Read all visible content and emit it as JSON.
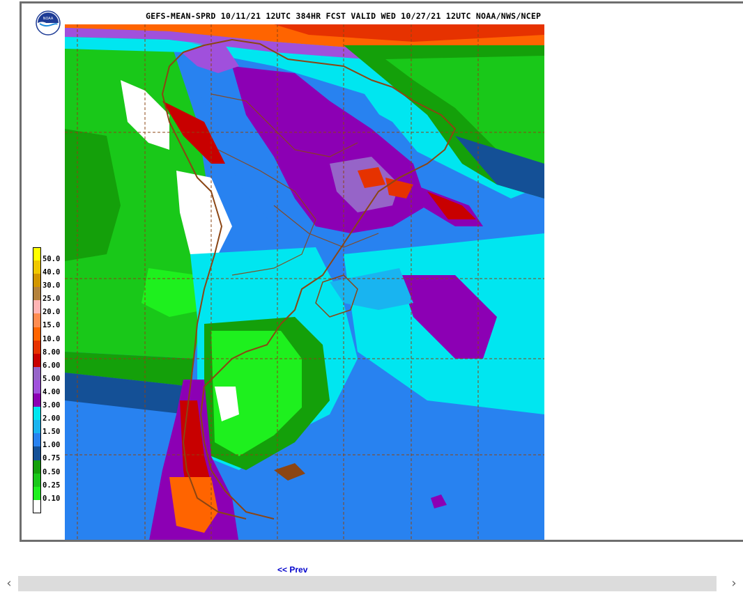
{
  "map": {
    "title": "GEFS-MEAN-SPRD 10/11/21 12UTC 384HR FCST VALID WED 10/27/21 12UTC NOAA/NWS/NCEP",
    "logo_icon": "noaa-logo-icon",
    "legend": [
      {
        "label": "50.0",
        "color": "#ffff00"
      },
      {
        "label": "40.0",
        "color": "#f0c800"
      },
      {
        "label": "30.0",
        "color": "#d29600"
      },
      {
        "label": "25.0",
        "color": "#b4823c"
      },
      {
        "label": "20.0",
        "color": "#ffb4b4"
      },
      {
        "label": "15.0",
        "color": "#ff8c50"
      },
      {
        "label": "10.0",
        "color": "#ff6400"
      },
      {
        "label": "8.00",
        "color": "#e63200"
      },
      {
        "label": "6.00",
        "color": "#c80000"
      },
      {
        "label": "5.00",
        "color": "#9664c8"
      },
      {
        "label": "4.00",
        "color": "#a050dc"
      },
      {
        "label": "3.00",
        "color": "#8c00b4"
      },
      {
        "label": "2.00",
        "color": "#00e6f0"
      },
      {
        "label": "1.50",
        "color": "#19b4f0"
      },
      {
        "label": "1.00",
        "color": "#2882f0"
      },
      {
        "label": "0.75",
        "color": "#145096"
      },
      {
        "label": "0.50",
        "color": "#14a00a"
      },
      {
        "label": "0.25",
        "color": "#19c819"
      },
      {
        "label": "0.10",
        "color": "#1ef01e"
      },
      {
        "label": "",
        "color": "#ffffff"
      }
    ],
    "colors": {
      "coastline": "#8b4513",
      "grid": "#8b4513"
    }
  },
  "nav": {
    "prev_label": "<< Prev"
  },
  "scrollbar": {
    "left_icon": "chevron-left-icon",
    "right_icon": "chevron-right-icon",
    "left_glyph": "‹",
    "right_glyph": "›"
  }
}
